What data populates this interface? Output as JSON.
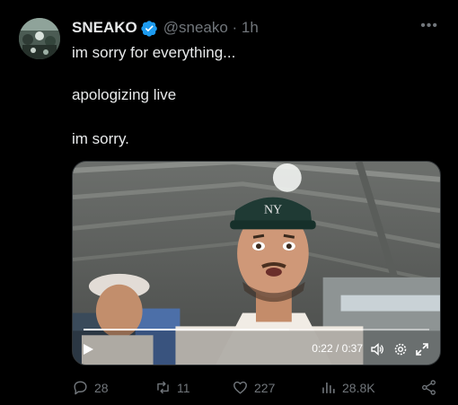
{
  "tweet": {
    "author_name": "SNEAKO",
    "handle_time": "@sneako · 1h",
    "lines": [
      "im sorry for everything...",
      "apologizing live",
      "im sorry."
    ],
    "verified": true
  },
  "video": {
    "time": "0:22 / 0:37",
    "progress": 0.595
  },
  "actions": {
    "replies": "28",
    "retweets": "11",
    "likes": "227",
    "views": "28.8K"
  },
  "colors": {
    "background": "#000000",
    "text": "#e7e9ea",
    "muted": "#71767b",
    "verified": "#1d9bf0"
  },
  "icons": [
    "more-icon",
    "verified-badge-icon",
    "play-icon",
    "volume-icon",
    "settings-gear-icon",
    "fullscreen-icon",
    "reply-icon",
    "retweet-icon",
    "like-icon",
    "views-icon",
    "share-icon"
  ]
}
